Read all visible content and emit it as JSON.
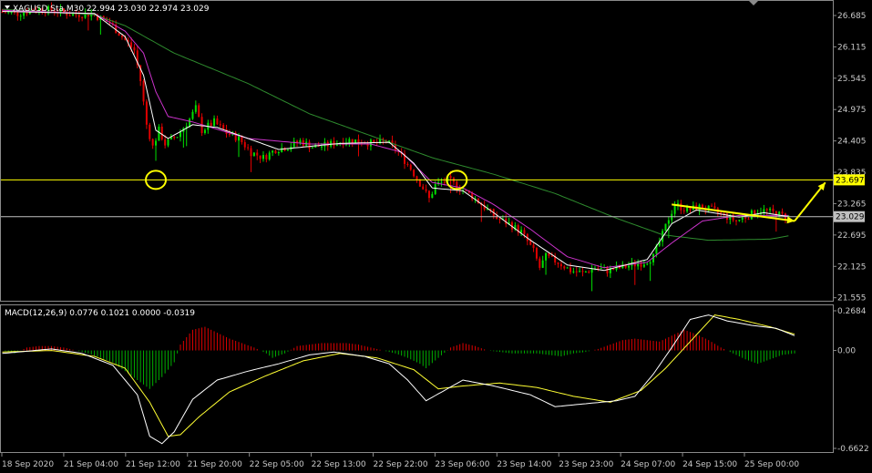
{
  "header": {
    "symbol_line": "XAGUSD.Sta,M30  22.994 23.030 22.974 23.029",
    "macd_line": "MACD(12,26,9) 0.0776 0.1021 0.0000 -0.0319"
  },
  "colors": {
    "background": "#000000",
    "frame": "#8a8a8a",
    "bull": "#00e000",
    "bear": "#e00000",
    "ma_fast": "#ffffff",
    "ma_mid": "#cc33cc",
    "ma_slow": "#2e8b2e",
    "signal": "#ffff33",
    "marker": "#ffff00",
    "hline": "#c0c0c0",
    "hist_pos": "#e00000",
    "hist_neg": "#00b000"
  },
  "chart_data": {
    "type": "candlestick",
    "symbol": "XAGUSD.Sta",
    "timeframe": "M30",
    "ohlc_current": {
      "open": 22.994,
      "high": 23.03,
      "low": 22.974,
      "close": 23.029
    },
    "price_axis": {
      "ticks": [
        "26.685",
        "26.115",
        "25.545",
        "24.975",
        "24.405",
        "23.835",
        "23.265",
        "22.695",
        "22.125",
        "21.555"
      ],
      "ylim": [
        21.5,
        26.95
      ]
    },
    "horizontal_lines": [
      {
        "value": 23.697,
        "label": "23.697",
        "color": "#ffff00"
      },
      {
        "value": 23.029,
        "label": "23.029",
        "color": "#c0c0c0"
      }
    ],
    "time_axis": [
      "18 Sep 2020",
      "21 Sep 04:00",
      "21 Sep 12:00",
      "21 Sep 20:00",
      "22 Sep 05:00",
      "22 Sep 13:00",
      "22 Sep 22:00",
      "23 Sep 06:00",
      "23 Sep 14:00",
      "23 Sep 23:00",
      "24 Sep 07:00",
      "24 Sep 15:00",
      "25 Sep 00:00"
    ],
    "price_path": [
      [
        0,
        26.75
      ],
      [
        6,
        26.72
      ],
      [
        12,
        26.8
      ],
      [
        18,
        26.78
      ],
      [
        24,
        26.7
      ],
      [
        30,
        26.72
      ],
      [
        36,
        26.55
      ],
      [
        40,
        26.3
      ],
      [
        44,
        26.05
      ],
      [
        46,
        25.5
      ],
      [
        48,
        24.7
      ],
      [
        50,
        24.3
      ],
      [
        52,
        24.6
      ],
      [
        54,
        24.35
      ],
      [
        58,
        24.5
      ],
      [
        62,
        24.8
      ],
      [
        64,
        25.0
      ],
      [
        66,
        24.6
      ],
      [
        70,
        24.75
      ],
      [
        74,
        24.55
      ],
      [
        78,
        24.45
      ],
      [
        82,
        24.2
      ],
      [
        86,
        24.1
      ],
      [
        90,
        24.25
      ],
      [
        94,
        24.3
      ],
      [
        98,
        24.4
      ],
      [
        102,
        24.3
      ],
      [
        106,
        24.32
      ],
      [
        110,
        24.38
      ],
      [
        114,
        24.42
      ],
      [
        118,
        24.4
      ],
      [
        122,
        24.35
      ],
      [
        126,
        24.4
      ],
      [
        130,
        24.2
      ],
      [
        134,
        23.9
      ],
      [
        138,
        23.55
      ],
      [
        140,
        23.35
      ],
      [
        142,
        23.6
      ],
      [
        146,
        23.7
      ],
      [
        150,
        23.55
      ],
      [
        154,
        23.4
      ],
      [
        158,
        23.2
      ],
      [
        162,
        23.0
      ],
      [
        166,
        22.9
      ],
      [
        170,
        22.75
      ],
      [
        174,
        22.4
      ],
      [
        176,
        22.1
      ],
      [
        178,
        22.3
      ],
      [
        182,
        22.2
      ],
      [
        186,
        22.05
      ],
      [
        190,
        22.0
      ],
      [
        194,
        22.1
      ],
      [
        198,
        22.05
      ],
      [
        202,
        22.1
      ],
      [
        206,
        22.15
      ],
      [
        210,
        22.2
      ],
      [
        213,
        22.3
      ],
      [
        216,
        22.7
      ],
      [
        218,
        23.0
      ],
      [
        220,
        23.25
      ],
      [
        224,
        23.15
      ],
      [
        228,
        23.2
      ],
      [
        232,
        23.15
      ],
      [
        236,
        23.05
      ],
      [
        240,
        22.95
      ],
      [
        244,
        23.05
      ],
      [
        248,
        23.15
      ],
      [
        252,
        23.1
      ],
      [
        256,
        23.03
      ]
    ],
    "ma_slow_path": [
      [
        0,
        26.8
      ],
      [
        30,
        26.7
      ],
      [
        40,
        26.5
      ],
      [
        56,
        26.0
      ],
      [
        80,
        25.45
      ],
      [
        100,
        24.9
      ],
      [
        120,
        24.5
      ],
      [
        140,
        24.1
      ],
      [
        160,
        23.8
      ],
      [
        180,
        23.45
      ],
      [
        200,
        23.0
      ],
      [
        215,
        22.7
      ],
      [
        230,
        22.6
      ],
      [
        250,
        22.62
      ],
      [
        256,
        22.68
      ]
    ],
    "ma_mid_path": [
      [
        0,
        26.78
      ],
      [
        30,
        26.72
      ],
      [
        40,
        26.4
      ],
      [
        46,
        26.0
      ],
      [
        50,
        25.3
      ],
      [
        54,
        24.85
      ],
      [
        62,
        24.75
      ],
      [
        80,
        24.45
      ],
      [
        100,
        24.35
      ],
      [
        120,
        24.35
      ],
      [
        130,
        24.2
      ],
      [
        140,
        23.65
      ],
      [
        150,
        23.55
      ],
      [
        160,
        23.25
      ],
      [
        172,
        22.8
      ],
      [
        184,
        22.3
      ],
      [
        196,
        22.1
      ],
      [
        210,
        22.2
      ],
      [
        218,
        22.55
      ],
      [
        228,
        22.95
      ],
      [
        240,
        23.05
      ],
      [
        256,
        23.05
      ]
    ],
    "ma_fast_path": [
      [
        0,
        26.76
      ],
      [
        30,
        26.72
      ],
      [
        40,
        26.3
      ],
      [
        46,
        25.6
      ],
      [
        50,
        24.6
      ],
      [
        54,
        24.45
      ],
      [
        62,
        24.7
      ],
      [
        70,
        24.65
      ],
      [
        90,
        24.25
      ],
      [
        110,
        24.36
      ],
      [
        126,
        24.38
      ],
      [
        134,
        24.0
      ],
      [
        140,
        23.55
      ],
      [
        150,
        23.5
      ],
      [
        160,
        23.1
      ],
      [
        172,
        22.6
      ],
      [
        184,
        22.15
      ],
      [
        196,
        22.05
      ],
      [
        210,
        22.25
      ],
      [
        218,
        22.9
      ],
      [
        226,
        23.15
      ],
      [
        240,
        23.02
      ],
      [
        248,
        23.1
      ],
      [
        256,
        23.03
      ]
    ],
    "markers": [
      {
        "type": "circle",
        "x_index": 50,
        "value": 23.697
      },
      {
        "type": "circle",
        "x_index": 148,
        "value": 23.697
      }
    ],
    "trendline": {
      "from": [
        218,
        23.25
      ],
      "to": [
        258,
        22.95
      ]
    },
    "arrow": {
      "from": [
        258,
        22.95
      ],
      "to": [
        268,
        23.65
      ]
    },
    "macd": {
      "label": "MACD(12,26,9)",
      "values": {
        "macd": 0.0776,
        "signal": 0.1021,
        "histogram_1": 0.0,
        "histogram_2": -0.0319
      },
      "axis_ticks": [
        "0.2684",
        "0.00",
        "-0.6622"
      ],
      "ylim": [
        -0.6622,
        0.2684
      ],
      "histogram": [
        [
          0,
          0.0
        ],
        [
          4,
          -0.02
        ],
        [
          8,
          0.02
        ],
        [
          12,
          0.03
        ],
        [
          16,
          0.03
        ],
        [
          20,
          0.02
        ],
        [
          24,
          0.0
        ],
        [
          28,
          -0.02
        ],
        [
          32,
          -0.05
        ],
        [
          36,
          -0.08
        ],
        [
          40,
          -0.14
        ],
        [
          44,
          -0.2
        ],
        [
          48,
          -0.26
        ],
        [
          52,
          -0.18
        ],
        [
          56,
          -0.08
        ],
        [
          58,
          0.04
        ],
        [
          62,
          0.14
        ],
        [
          66,
          0.16
        ],
        [
          70,
          0.12
        ],
        [
          74,
          0.08
        ],
        [
          78,
          0.05
        ],
        [
          82,
          0.02
        ],
        [
          86,
          -0.02
        ],
        [
          88,
          -0.05
        ],
        [
          92,
          -0.02
        ],
        [
          96,
          0.03
        ],
        [
          100,
          0.04
        ],
        [
          104,
          0.05
        ],
        [
          108,
          0.05
        ],
        [
          112,
          0.05
        ],
        [
          116,
          0.04
        ],
        [
          120,
          0.02
        ],
        [
          124,
          0.0
        ],
        [
          128,
          -0.02
        ],
        [
          132,
          -0.05
        ],
        [
          136,
          -0.09
        ],
        [
          138,
          -0.12
        ],
        [
          142,
          -0.05
        ],
        [
          146,
          0.02
        ],
        [
          150,
          0.05
        ],
        [
          154,
          0.03
        ],
        [
          158,
          0.0
        ],
        [
          162,
          -0.01
        ],
        [
          166,
          -0.02
        ],
        [
          170,
          -0.02
        ],
        [
          174,
          -0.02
        ],
        [
          178,
          -0.03
        ],
        [
          182,
          -0.04
        ],
        [
          186,
          -0.02
        ],
        [
          190,
          -0.01
        ],
        [
          194,
          0.01
        ],
        [
          198,
          0.04
        ],
        [
          202,
          0.07
        ],
        [
          206,
          0.08
        ],
        [
          210,
          0.07
        ],
        [
          214,
          0.06
        ],
        [
          218,
          0.1
        ],
        [
          222,
          0.14
        ],
        [
          226,
          0.11
        ],
        [
          230,
          0.07
        ],
        [
          234,
          0.02
        ],
        [
          238,
          -0.02
        ],
        [
          242,
          -0.06
        ],
        [
          246,
          -0.09
        ],
        [
          250,
          -0.06
        ],
        [
          254,
          -0.03
        ],
        [
          258,
          -0.02
        ]
      ],
      "macd_path": [
        [
          0,
          -0.02
        ],
        [
          16,
          0.01
        ],
        [
          26,
          -0.02
        ],
        [
          36,
          -0.1
        ],
        [
          44,
          -0.3
        ],
        [
          48,
          -0.58
        ],
        [
          52,
          -0.63
        ],
        [
          56,
          -0.55
        ],
        [
          62,
          -0.33
        ],
        [
          70,
          -0.2
        ],
        [
          80,
          -0.14
        ],
        [
          90,
          -0.09
        ],
        [
          100,
          -0.03
        ],
        [
          108,
          -0.01
        ],
        [
          118,
          -0.04
        ],
        [
          126,
          -0.09
        ],
        [
          132,
          -0.2
        ],
        [
          138,
          -0.34
        ],
        [
          144,
          -0.27
        ],
        [
          150,
          -0.2
        ],
        [
          160,
          -0.24
        ],
        [
          172,
          -0.3
        ],
        [
          180,
          -0.38
        ],
        [
          190,
          -0.36
        ],
        [
          200,
          -0.34
        ],
        [
          206,
          -0.31
        ],
        [
          212,
          -0.16
        ],
        [
          218,
          0.02
        ],
        [
          224,
          0.21
        ],
        [
          230,
          0.24
        ],
        [
          236,
          0.2
        ],
        [
          244,
          0.17
        ],
        [
          252,
          0.15
        ],
        [
          258,
          0.1
        ]
      ],
      "signal_path": [
        [
          0,
          -0.01
        ],
        [
          16,
          0.0
        ],
        [
          30,
          -0.04
        ],
        [
          40,
          -0.12
        ],
        [
          48,
          -0.35
        ],
        [
          54,
          -0.58
        ],
        [
          58,
          -0.57
        ],
        [
          64,
          -0.45
        ],
        [
          74,
          -0.28
        ],
        [
          86,
          -0.17
        ],
        [
          98,
          -0.07
        ],
        [
          110,
          -0.02
        ],
        [
          122,
          -0.05
        ],
        [
          134,
          -0.13
        ],
        [
          142,
          -0.26
        ],
        [
          150,
          -0.24
        ],
        [
          162,
          -0.22
        ],
        [
          174,
          -0.25
        ],
        [
          186,
          -0.31
        ],
        [
          198,
          -0.35
        ],
        [
          208,
          -0.27
        ],
        [
          216,
          -0.12
        ],
        [
          224,
          0.06
        ],
        [
          232,
          0.24
        ],
        [
          240,
          0.21
        ],
        [
          250,
          0.16
        ],
        [
          258,
          0.11
        ]
      ]
    }
  }
}
